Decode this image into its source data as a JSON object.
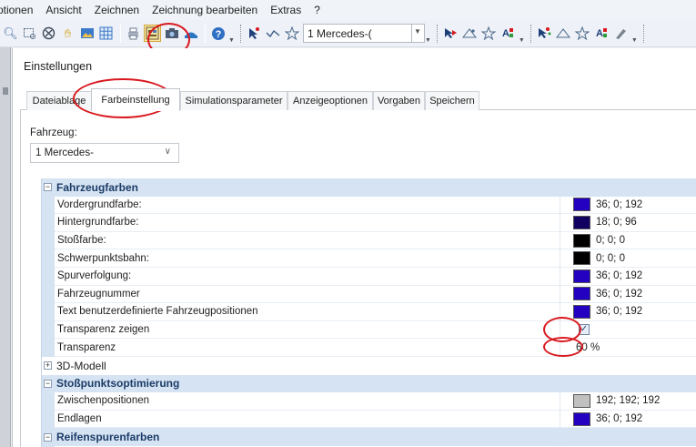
{
  "menubar": {
    "items": [
      "ptionen",
      "Ansicht",
      "Zeichnen",
      "Zeichnung bearbeiten",
      "Extras",
      "?"
    ]
  },
  "toolbar": {
    "vehicle_combo_value": "1 Mercedes-(",
    "icons": [
      "zoom-icon",
      "zoom-window-icon",
      "zoom-reset-icon",
      "pan-hand-icon",
      "image-icon",
      "grid-icon",
      "print-icon",
      "settings-dialog-icon",
      "camera-icon",
      "save-icon",
      "help-icon",
      "select-arrow-icon",
      "polyline-icon",
      "star-marker-icon"
    ]
  },
  "dialog": {
    "title": "Einstellungen",
    "tabs": [
      "Dateiablage",
      "Farbeinstellung",
      "Simulationsparameter",
      "Anzeigeoptionen",
      "Vorgaben",
      "Speichern"
    ],
    "active_tab": "Farbeinstellung",
    "vehicle_label": "Fahrzeug:",
    "vehicle_value": "1 Mercedes-"
  },
  "grid": {
    "fahrzeugfarben": {
      "label": "Fahrzeugfarben",
      "rows": [
        {
          "name": "Vordergrundfarbe:",
          "value": "36; 0; 192",
          "color": "#2400c0"
        },
        {
          "name": "Hintergrundfarbe:",
          "value": "18; 0; 96",
          "color": "#120060"
        },
        {
          "name": "Stoßfarbe:",
          "value": "0; 0; 0",
          "color": "#000000"
        },
        {
          "name": "Schwerpunktsbahn:",
          "value": "0; 0; 0",
          "color": "#000000"
        },
        {
          "name": "Spurverfolgung:",
          "value": "36; 0; 192",
          "color": "#2400c0"
        },
        {
          "name": "Fahrzeugnummer",
          "value": "36; 0; 192",
          "color": "#2400c0"
        },
        {
          "name": "Text benutzerdefinierte Fahrzeugpositionen",
          "value": "36; 0; 192",
          "color": "#2400c0"
        }
      ],
      "transparenz_zeigen": {
        "name": "Transparenz zeigen",
        "checked": true
      },
      "transparenz": {
        "name": "Transparenz",
        "value": "60 %"
      }
    },
    "modell3d": {
      "label": "3D-Modell"
    },
    "stosspunkt": {
      "label": "Stoßpunktsoptimierung",
      "rows": [
        {
          "name": "Zwischenpositionen",
          "value": "192; 192; 192",
          "color": "#c0c0c0"
        },
        {
          "name": "Endlagen",
          "value": "36; 0; 192",
          "color": "#2400c0"
        }
      ]
    },
    "reifenspuren": {
      "label": "Reifenspurenfarben"
    }
  }
}
